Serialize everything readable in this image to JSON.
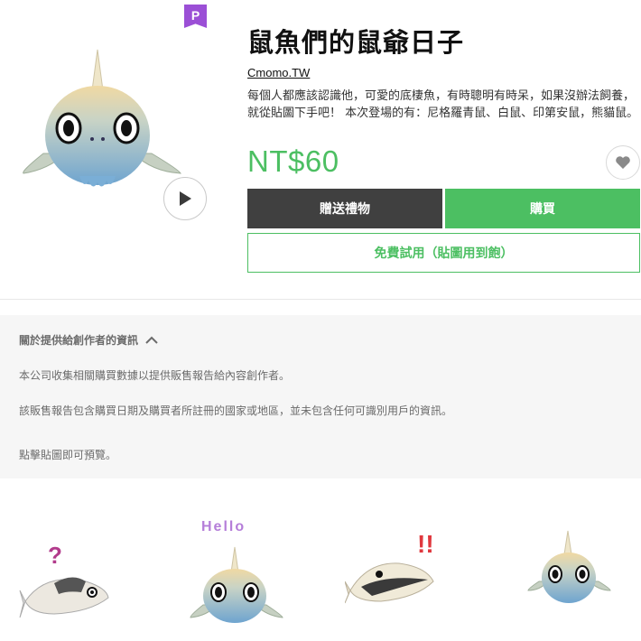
{
  "product": {
    "badge": "P",
    "title": "鼠魚們的鼠爺日子",
    "author": "Cmomo.TW",
    "description": "每個人都應該認識他，可愛的底棲魚，有時聰明有時呆，如果沒辦法飼養，就從貼圖下手吧！ 本次登場的有：尼格羅青鼠、白鼠、印第安鼠，熊貓鼠。",
    "price": "NT$60",
    "play_icon": "play-icon",
    "favorite_icon": "heart-icon"
  },
  "buttons": {
    "gift": "贈送禮物",
    "buy": "購買",
    "trial": "免費試用（貼圖用到飽）"
  },
  "info": {
    "header": "關於提供給創作者的資訊",
    "toggle_icon": "chevron-up-icon",
    "line1": "本公司收集相關購買數據以提供販售報告給內容創作者。",
    "line2": "該販售報告包含購買日期及購買者所註冊的國家或地區，並未包含任何可識別用戶的資訊。",
    "line3": "點擊貼圖即可預覽。"
  },
  "stickers": [
    {
      "caption": "?"
    },
    {
      "caption": "Hello"
    },
    {
      "caption": "!!"
    },
    {
      "caption": ""
    }
  ],
  "colors": {
    "accent_green": "#4cbf62",
    "dark_button": "#404040",
    "badge_purple": "#9b4fd6",
    "panel_bg": "#f6f6f6"
  }
}
